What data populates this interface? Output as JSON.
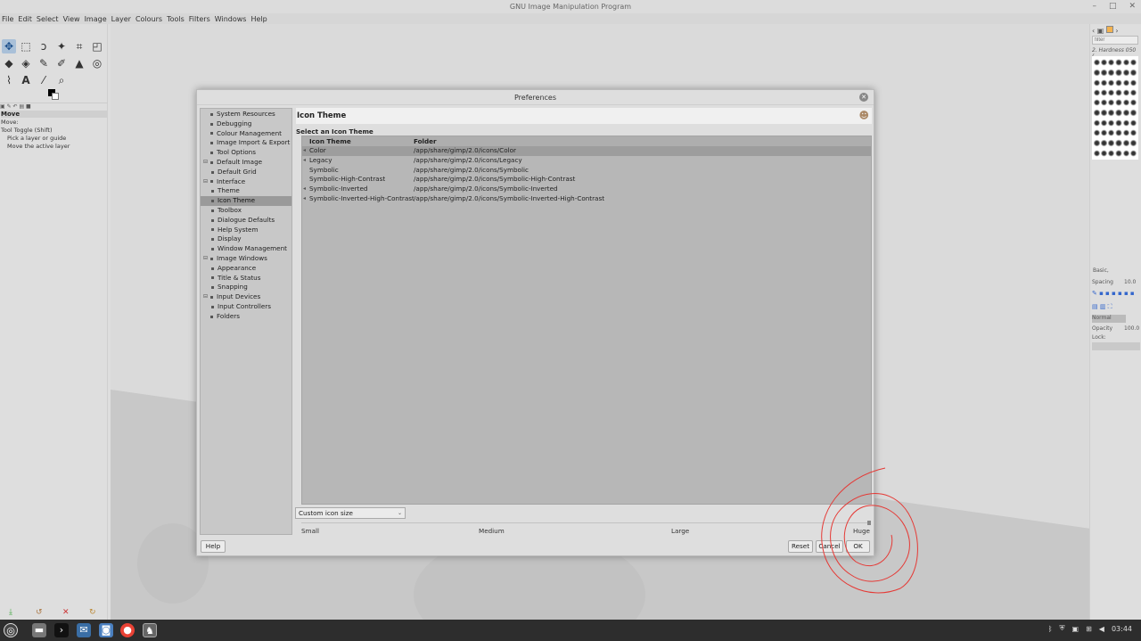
{
  "window": {
    "title": "GNU Image Manipulation Program"
  },
  "menu": [
    "File",
    "Edit",
    "Select",
    "View",
    "Image",
    "Layer",
    "Colours",
    "Tools",
    "Filters",
    "Windows",
    "Help"
  ],
  "tool_options": {
    "title": "Move",
    "mode_label": "Move:",
    "toggle_label": "Tool Toggle  (Shift)",
    "option1": "Pick a layer or guide",
    "option2": "Move the active layer"
  },
  "right_dock": {
    "filter_placeholder": "filter",
    "brush_name": "2. Hardness 050 (…",
    "preset": "Basic,",
    "spacing_label": "Spacing",
    "spacing_value": "10.0",
    "mode": "Normal",
    "opacity_label": "Opacity",
    "opacity_value": "100.0",
    "lock_label": "Lock:"
  },
  "dialog": {
    "title": "Preferences",
    "tree": [
      {
        "label": "System Resources",
        "level": 0,
        "icon": "chip-icon"
      },
      {
        "label": "Debugging",
        "level": 0,
        "icon": "bug-icon"
      },
      {
        "label": "Colour Management",
        "level": 0,
        "icon": "color-icon"
      },
      {
        "label": "Image Import & Export",
        "level": 0,
        "icon": "import-icon"
      },
      {
        "label": "Tool Options",
        "level": 0,
        "icon": "tool-icon"
      },
      {
        "label": "Default Image",
        "level": 0,
        "icon": "image-icon",
        "expanded": true
      },
      {
        "label": "Default Grid",
        "level": 1,
        "icon": "grid-icon"
      },
      {
        "label": "Interface",
        "level": 0,
        "icon": "interface-icon",
        "expanded": true
      },
      {
        "label": "Theme",
        "level": 1,
        "icon": "theme-icon"
      },
      {
        "label": "Icon Theme",
        "level": 1,
        "icon": "icon-theme-icon",
        "selected": true
      },
      {
        "label": "Toolbox",
        "level": 1,
        "icon": "toolbox-icon"
      },
      {
        "label": "Dialogue Defaults",
        "level": 1,
        "icon": "dialog-icon"
      },
      {
        "label": "Help System",
        "level": 1,
        "icon": "help-icon"
      },
      {
        "label": "Display",
        "level": 1,
        "icon": "display-icon"
      },
      {
        "label": "Window Management",
        "level": 1,
        "icon": "window-icon"
      },
      {
        "label": "Image Windows",
        "level": 0,
        "icon": "image-windows-icon",
        "expanded": true
      },
      {
        "label": "Appearance",
        "level": 1,
        "icon": "appearance-icon"
      },
      {
        "label": "Title & Status",
        "level": 1,
        "icon": "title-icon"
      },
      {
        "label": "Snapping",
        "level": 1,
        "icon": "snap-icon"
      },
      {
        "label": "Input Devices",
        "level": 0,
        "icon": "input-icon",
        "expanded": true
      },
      {
        "label": "Input Controllers",
        "level": 1,
        "icon": "controller-icon"
      },
      {
        "label": "Folders",
        "level": 0,
        "icon": "folder-icon"
      }
    ],
    "page_title": "Icon Theme",
    "section_label": "Select an Icon Theme",
    "table": {
      "headers": [
        "Icon Theme",
        "Folder"
      ],
      "rows": [
        {
          "theme": "Color",
          "folder": "/app/share/gimp/2.0/icons/Color",
          "selected": true
        },
        {
          "theme": "Legacy",
          "folder": "/app/share/gimp/2.0/icons/Legacy"
        },
        {
          "theme": "Symbolic",
          "folder": "/app/share/gimp/2.0/icons/Symbolic"
        },
        {
          "theme": "Symbolic-High-Contrast",
          "folder": "/app/share/gimp/2.0/icons/Symbolic-High-Contrast"
        },
        {
          "theme": "Symbolic-Inverted",
          "folder": "/app/share/gimp/2.0/icons/Symbolic-Inverted"
        },
        {
          "theme": "Symbolic-Inverted-High-Contrast",
          "folder": "/app/share/gimp/2.0/icons/Symbolic-Inverted-High-Contrast"
        }
      ]
    },
    "icon_size_combo": "Custom icon size",
    "size_labels": {
      "small": "Small",
      "medium": "Medium",
      "large": "Large",
      "huge": "Huge"
    },
    "buttons": {
      "help": "Help",
      "reset": "Reset",
      "cancel": "Cancel",
      "ok": "OK"
    }
  },
  "taskbar": {
    "clock": "03:44"
  },
  "colors": {
    "annotation": "#e53935",
    "selection": "#9d9d9d"
  }
}
